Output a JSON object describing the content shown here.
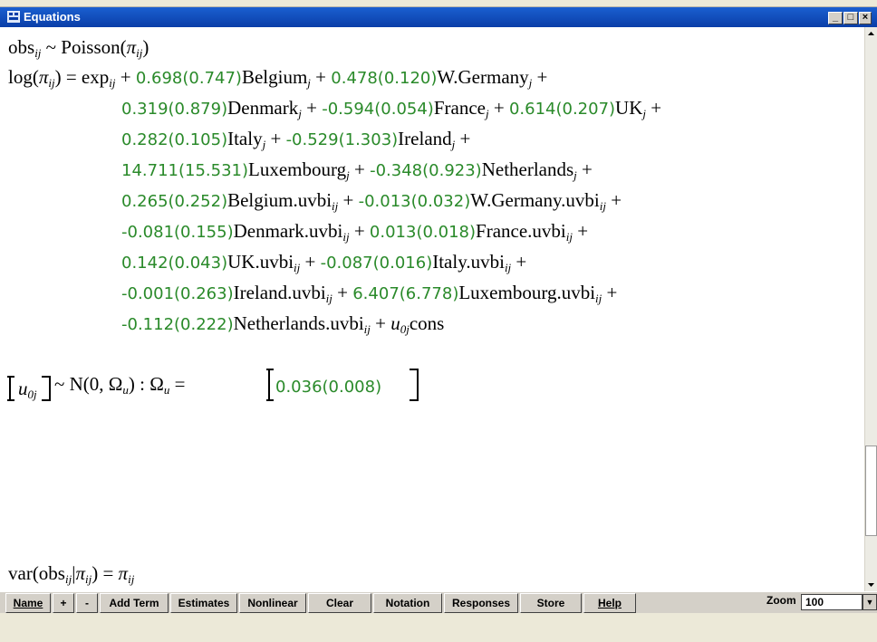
{
  "window": {
    "title": "Equations",
    "minimize": "_",
    "maximize": "□",
    "close": "×"
  },
  "eq1": {
    "lhs": "obs",
    "sub": "ij",
    "tilde": " ~ Poisson(",
    "pi": "π",
    "pisub": "ij",
    "close": ")"
  },
  "eq2": {
    "lhs_pre": "log(",
    "pi": "π",
    "pisub": "ij",
    "lhs_post": ") = exp",
    "expsub": "ij",
    "plus": " + ",
    "terms": [
      {
        "coef": "0.698(0.747)",
        "name": "Belgium",
        "sub": "j"
      },
      {
        "coef": "0.478(0.120)",
        "name": "W.Germany",
        "sub": "j"
      },
      {
        "coef": "0.319(0.879)",
        "name": "Denmark",
        "sub": "j"
      },
      {
        "coef": "-0.594(0.054)",
        "name": "France",
        "sub": "j"
      },
      {
        "coef": "0.614(0.207)",
        "name": "UK",
        "sub": "j"
      },
      {
        "coef": "0.282(0.105)",
        "name": "Italy",
        "sub": "j"
      },
      {
        "coef": "-0.529(1.303)",
        "name": "Ireland",
        "sub": "j"
      },
      {
        "coef": "14.711(15.531)",
        "name": "Luxembourg",
        "sub": "j"
      },
      {
        "coef": "-0.348(0.923)",
        "name": "Netherlands",
        "sub": "j"
      },
      {
        "coef": "0.265(0.252)",
        "name": "Belgium.uvbi",
        "sub": "ij"
      },
      {
        "coef": "-0.013(0.032)",
        "name": "W.Germany.uvbi",
        "sub": "ij"
      },
      {
        "coef": "-0.081(0.155)",
        "name": "Denmark.uvbi",
        "sub": "ij"
      },
      {
        "coef": "0.013(0.018)",
        "name": "France.uvbi",
        "sub": "ij"
      },
      {
        "coef": "0.142(0.043)",
        "name": "UK.uvbi",
        "sub": "ij"
      },
      {
        "coef": "-0.087(0.016)",
        "name": "Italy.uvbi",
        "sub": "ij"
      },
      {
        "coef": "-0.001(0.263)",
        "name": "Ireland.uvbi",
        "sub": "ij"
      },
      {
        "coef": "6.407(6.778)",
        "name": "Luxembourg.uvbi",
        "sub": "ij"
      },
      {
        "coef": "-0.112(0.222)",
        "name": "Netherlands.uvbi",
        "sub": "ij"
      }
    ],
    "tail_plus": " + ",
    "u": "u",
    "usub": "0j",
    "cons": "cons"
  },
  "eq3": {
    "u": "u",
    "usub": "0j",
    "dist": "~ N(0,  Ω",
    "omegasub": "u",
    "dist_close": ")  :  Ω",
    "eq": "u",
    "equals": " = ",
    "value": "0.036(0.008)"
  },
  "eq4": {
    "lhs": "var(obs",
    "sub": "ij",
    "bar": "|",
    "pi": "π",
    "pisub": "ij",
    "close": ") = ",
    "rhs": "π",
    "rhssub": "ij"
  },
  "toolbar": {
    "name": "Name",
    "plus": "+",
    "minus": "-",
    "add_term": "Add Term",
    "estimates": "Estimates",
    "nonlinear": "Nonlinear",
    "clear": "Clear",
    "notation": "Notation",
    "responses": "Responses",
    "store": "Store",
    "help": "Help",
    "zoom_label": "Zoom",
    "zoom_value": "100"
  }
}
